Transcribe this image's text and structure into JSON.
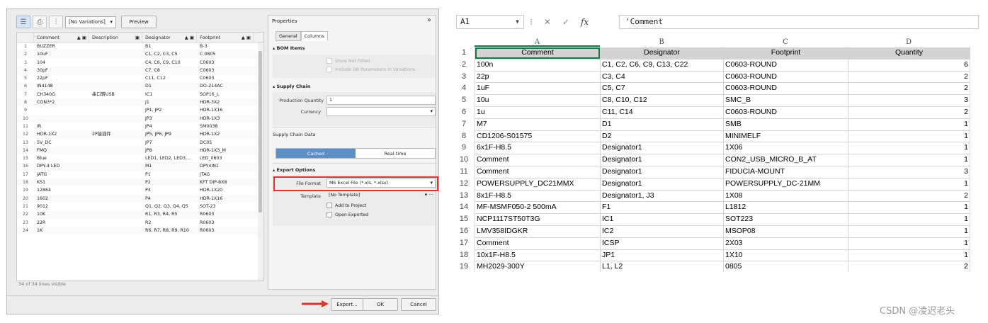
{
  "bom": {
    "toolbar": {
      "variant": "[No Variations]",
      "preview": "Preview"
    },
    "columns": [
      "Comment",
      "Description",
      "Designator",
      "Footprint"
    ],
    "rows": [
      [
        "1",
        "BUZZER",
        "",
        "B1",
        "B-3"
      ],
      [
        "2",
        "10uF",
        "",
        "C1, C2, C3, C5",
        "C 0805"
      ],
      [
        "3",
        "104",
        "",
        "C4, C6, C9, C10",
        "C0603"
      ],
      [
        "4",
        "30pF",
        "",
        "C7, C8",
        "C0603"
      ],
      [
        "5",
        "22pF",
        "",
        "C11, C12",
        "C0603"
      ],
      [
        "6",
        "IN4148",
        "",
        "D1",
        "DO-214AC"
      ],
      [
        "7",
        "CH340G",
        "串口转USB",
        "IC1",
        "SOP16_L"
      ],
      [
        "8",
        "CON3*2",
        "",
        "J1",
        "HDR-3X2"
      ],
      [
        "9",
        "",
        "",
        "JP1, JP2",
        "HDR-1X16"
      ],
      [
        "10",
        "",
        "",
        "JP3",
        "HDR-1X3"
      ],
      [
        "11",
        "IR",
        "",
        "JP4",
        "SM0038"
      ],
      [
        "12",
        "HDR-1X2",
        "2P接插件",
        "JP5, JP6, JP9",
        "HDR-1X2"
      ],
      [
        "13",
        "5V_DC",
        "",
        "JP7",
        "DC05"
      ],
      [
        "14",
        "FMQ",
        "",
        "JP8",
        "HDR-1X3_M"
      ],
      [
        "15",
        "Blue",
        "",
        "LED1, LED2, LED3,...",
        "LED_0603"
      ],
      [
        "16",
        "DPY-4 LED",
        "",
        "M1",
        "DPY4IN1"
      ],
      [
        "17",
        "JATG",
        "",
        "P1",
        "JTAG"
      ],
      [
        "18",
        "KS1",
        "",
        "P2",
        "KFT DIP-8X8"
      ],
      [
        "19",
        "12864",
        "",
        "P3",
        "HDR-1X20"
      ],
      [
        "20",
        "1602",
        "",
        "P4",
        "HDR-1X16"
      ],
      [
        "21",
        "9012",
        "",
        "Q1, Q2, Q3, Q4, Q5",
        "SOT-23"
      ],
      [
        "22",
        "10K",
        "",
        "R1, R3, R4, R5",
        "R0603"
      ],
      [
        "23",
        "22R",
        "",
        "R2",
        "R0603"
      ],
      [
        "24",
        "1K",
        "",
        "R6, R7, R8, R9, R10",
        "R0603"
      ]
    ],
    "lines_visible": "34 of 34 lines visible",
    "properties": {
      "title": "Properties",
      "tab_general": "General",
      "tab_columns": "Columns",
      "bom_items": "BOM Items",
      "show_not_fitted": "Show Not Fitted",
      "include_db": "Include DB Parameters in Variations",
      "supply_chain": "Supply Chain",
      "production_qty_label": "Production Quantity",
      "production_qty": "1",
      "currency_label": "Currency",
      "supply_chain_data": "Supply Chain Data",
      "cached": "Cached",
      "realtime": "Real-time",
      "export_options": "Export Options",
      "file_format_label": "File Format",
      "file_format": "MS Excel File (*.xls, *.xlsx)",
      "template_label": "Template",
      "template": "[No Template]",
      "add_to_project": "Add to Project",
      "open_exported": "Open Exported"
    },
    "buttons": {
      "export": "Export...",
      "ok": "OK",
      "cancel": "Cancel"
    }
  },
  "excel": {
    "name_box": "A1",
    "formula": "'Comment",
    "col_letters": [
      "A",
      "B",
      "C",
      "D"
    ],
    "rows": [
      [
        "1",
        "Comment",
        "Designator",
        "Footprint",
        "Quantity"
      ],
      [
        "2",
        "100n",
        "C1, C2, C6, C9, C13, C22",
        "C0603-ROUND",
        "6"
      ],
      [
        "3",
        "22p",
        "C3, C4",
        "C0603-ROUND",
        "2"
      ],
      [
        "4",
        "1uF",
        "C5, C7",
        "C0603-ROUND",
        "2"
      ],
      [
        "5",
        "10u",
        "C8, C10, C12",
        "SMC_B",
        "3"
      ],
      [
        "6",
        "1u",
        "C11, C14",
        "C0603-ROUND",
        "2"
      ],
      [
        "7",
        "M7",
        "D1",
        "SMB",
        "1"
      ],
      [
        "8",
        "CD1206-S01575",
        "D2",
        "MINIMELF",
        "1"
      ],
      [
        "9",
        "6x1F-H8.5",
        "Designator1",
        "1X06",
        "1"
      ],
      [
        "10",
        "Comment",
        "Designator1",
        "CON2_USB_MICRO_B_AT",
        "1"
      ],
      [
        "11",
        "Comment",
        "Designator1",
        "FIDUCIA-MOUNT",
        "3"
      ],
      [
        "12",
        "POWERSUPPLY_DC21MMX",
        "Designator1",
        "POWERSUPPLY_DC-21MM",
        "1"
      ],
      [
        "13",
        "8x1F-H8.5",
        "Designator1, J3",
        "1X08",
        "2"
      ],
      [
        "14",
        "MF-MSMF050-2 500mA",
        "F1",
        "L1812",
        "1"
      ],
      [
        "15",
        "NCP1117ST50T3G",
        "IC1",
        "SOT223",
        "1"
      ],
      [
        "16",
        "LMV358IDGKR",
        "IC2",
        "MSOP08",
        "1"
      ],
      [
        "17",
        "Comment",
        "ICSP",
        "2X03",
        "1"
      ],
      [
        "18",
        "10x1F-H8.5",
        "JP1",
        "1X10",
        "1"
      ],
      [
        "19",
        "MH2029-300Y",
        "L1, L2",
        "0805",
        "2"
      ]
    ]
  },
  "watermark": "CSDN @凌迟老头"
}
